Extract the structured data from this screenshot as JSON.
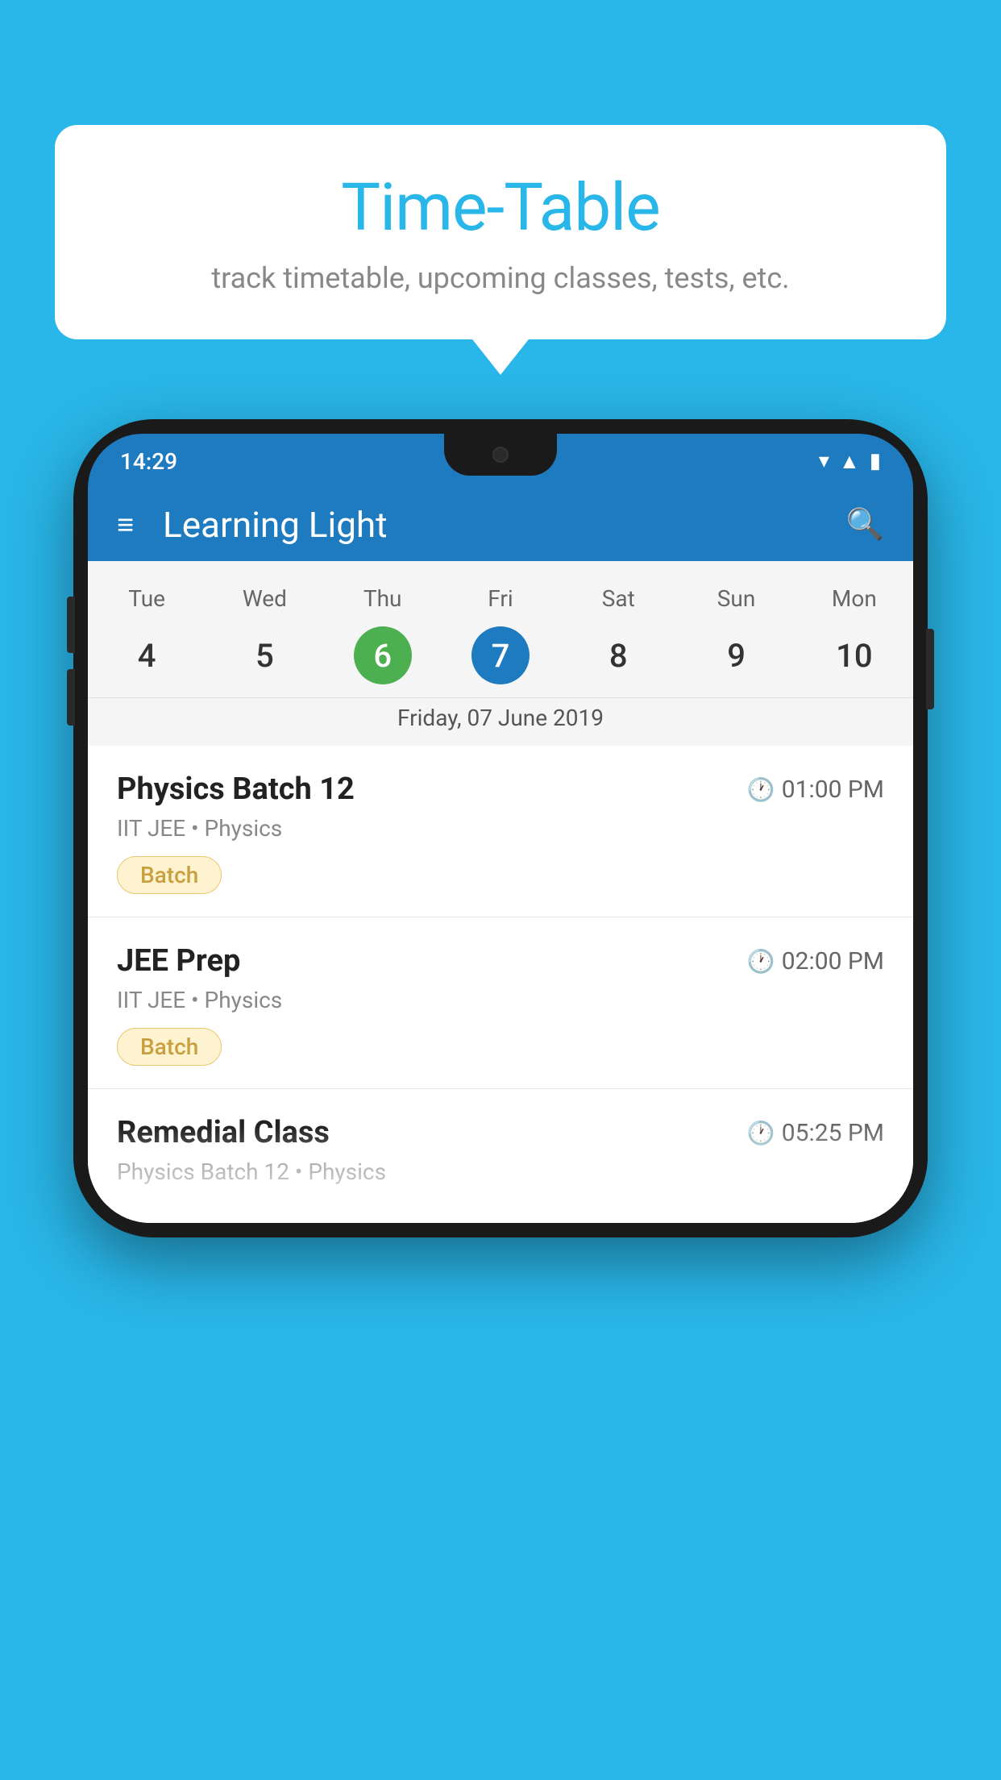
{
  "background": {
    "color": "#29b6e8"
  },
  "bubble": {
    "title": "Time-Table",
    "subtitle": "track timetable, upcoming classes, tests, etc."
  },
  "app": {
    "title": "Learning Light"
  },
  "status_bar": {
    "time": "14:29"
  },
  "calendar": {
    "selected_date_label": "Friday, 07 June 2019",
    "days": [
      "Tue",
      "Wed",
      "Thu",
      "Fri",
      "Sat",
      "Sun",
      "Mon"
    ],
    "dates": [
      "4",
      "5",
      "6",
      "7",
      "8",
      "9",
      "10"
    ],
    "today_index": 2,
    "selected_index": 3
  },
  "schedule": [
    {
      "title": "Physics Batch 12",
      "time": "01:00 PM",
      "subtitle": "IIT JEE • Physics",
      "badge": "Batch"
    },
    {
      "title": "JEE Prep",
      "time": "02:00 PM",
      "subtitle": "IIT JEE • Physics",
      "badge": "Batch"
    },
    {
      "title": "Remedial Class",
      "time": "05:25 PM",
      "subtitle": "Physics Batch 12 • Physics",
      "badge": ""
    }
  ]
}
